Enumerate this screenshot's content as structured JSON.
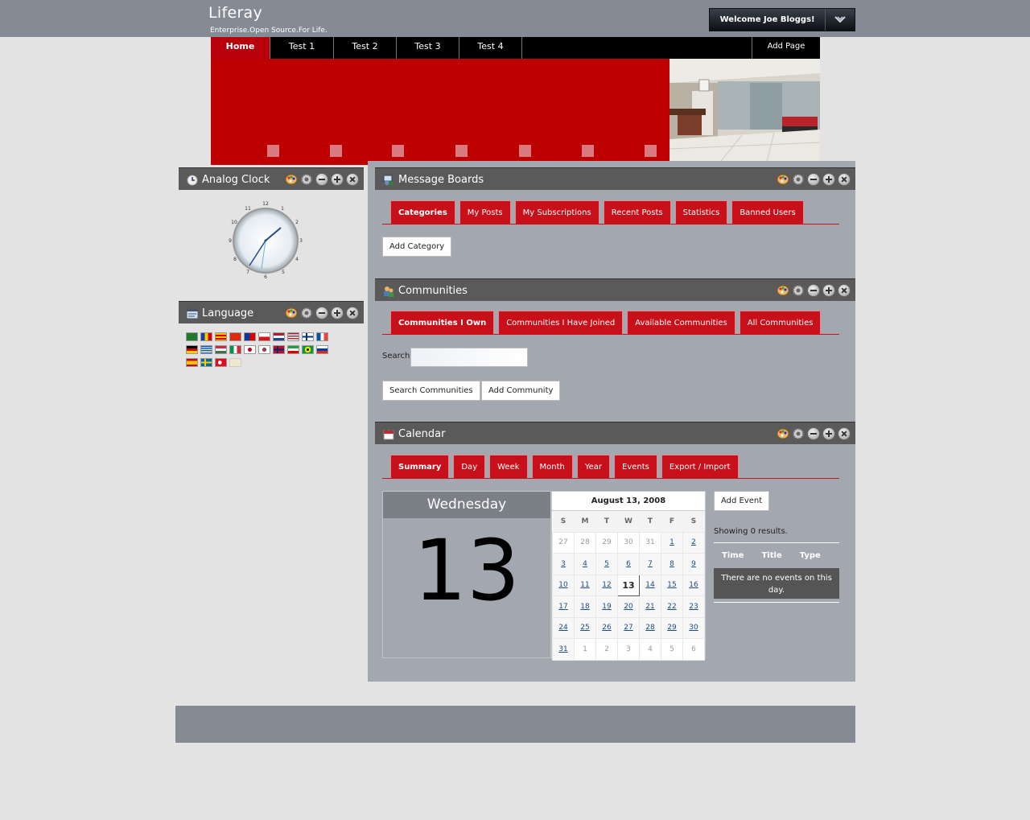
{
  "header": {
    "logo": "Liferay",
    "tagline": "Enterprise.Open Source.For Life.",
    "welcome": "Welcome Joe Bloggs!"
  },
  "nav": {
    "items": [
      "Home",
      "Test 1",
      "Test 2",
      "Test 3",
      "Test 4"
    ],
    "add_page": "Add Page"
  },
  "clock_portlet": {
    "title": "Analog Clock"
  },
  "language_portlet": {
    "title": "Language"
  },
  "message_boards": {
    "title": "Message Boards",
    "tabs": [
      "Categories",
      "My Posts",
      "My Subscriptions",
      "Recent Posts",
      "Statistics",
      "Banned Users"
    ],
    "add_category": "Add Category"
  },
  "communities": {
    "title": "Communities",
    "tabs": [
      "Communities I Own",
      "Communities I Have Joined",
      "Available Communities",
      "All Communities"
    ],
    "search_label": "Search",
    "search_value": "",
    "search_button": "Search Communities",
    "add_button": "Add Community"
  },
  "calendar": {
    "title": "Calendar",
    "tabs": [
      "Summary",
      "Day",
      "Week",
      "Month",
      "Year",
      "Events",
      "Export / Import"
    ],
    "day_name": "Wednesday",
    "day_number": "13",
    "month_title": "August 13, 2008",
    "weekdays": [
      "S",
      "M",
      "T",
      "W",
      "T",
      "F",
      "S"
    ],
    "weeks": [
      [
        "27",
        "28",
        "29",
        "30",
        "31",
        "1",
        "2"
      ],
      [
        "3",
        "4",
        "5",
        "6",
        "7",
        "8",
        "9"
      ],
      [
        "10",
        "11",
        "12",
        "13",
        "14",
        "15",
        "16"
      ],
      [
        "17",
        "18",
        "19",
        "20",
        "21",
        "22",
        "23"
      ],
      [
        "24",
        "25",
        "26",
        "27",
        "28",
        "29",
        "30"
      ],
      [
        "31",
        "1",
        "2",
        "3",
        "4",
        "5",
        "6"
      ]
    ],
    "add_event": "Add Event",
    "results": "Showing 0 results.",
    "columns": [
      "Time",
      "Title",
      "Type"
    ],
    "empty": "There are no events on this day."
  },
  "colors": {
    "accent_red": "#c8101a",
    "header_gray": "#858b94",
    "portlet_bar": "#5a5a5a"
  }
}
